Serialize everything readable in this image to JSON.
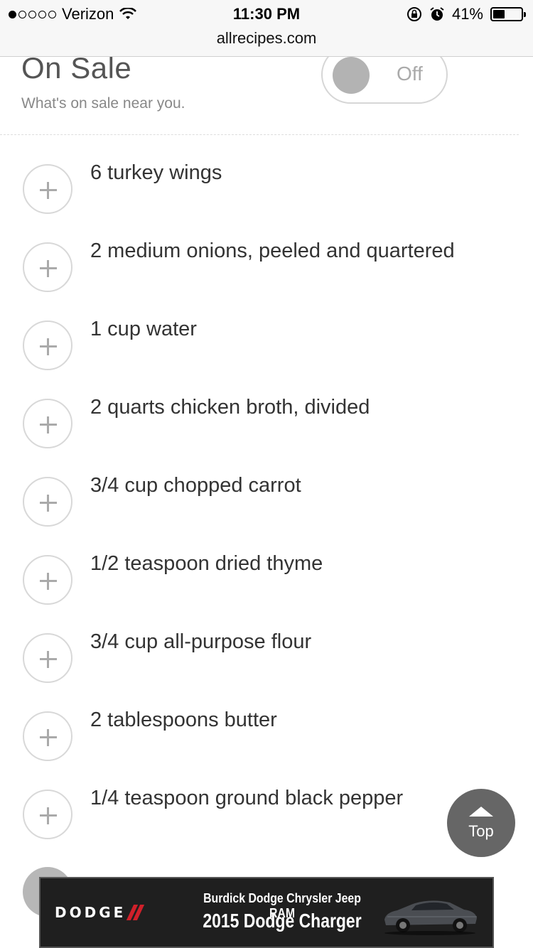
{
  "status_bar": {
    "carrier": "Verizon",
    "time": "11:30 PM",
    "battery_percent": "41%",
    "battery_level": 0.41,
    "signal_bars_filled": 1,
    "signal_bars_total": 5
  },
  "browser": {
    "url": "allrecipes.com"
  },
  "on_sale": {
    "title": "On Sale",
    "subtitle": "What's on sale near you.",
    "toggle_label": "Off",
    "toggle_on": false
  },
  "ingredients": [
    {
      "label": "6 turkey wings"
    },
    {
      "label": "2 medium onions, peeled and quartered"
    },
    {
      "label": "1 cup water"
    },
    {
      "label": "2 quarts chicken broth, divided"
    },
    {
      "label": "3/4 cup chopped carrot"
    },
    {
      "label": "1/2 teaspoon dried thyme"
    },
    {
      "label": "3/4 cup all-purpose flour"
    },
    {
      "label": "2 tablespoons butter"
    },
    {
      "label": "1/4 teaspoon ground black pepper"
    }
  ],
  "back_to_top": {
    "label": "Top"
  },
  "ad": {
    "brand": "DODGE",
    "dealer": "Burdick Dodge Chrysler Jeep RAM",
    "headline": "2015 Dodge Charger"
  },
  "colors": {
    "accent_red": "#d0202a",
    "text": "#333333",
    "muted": "#888888",
    "top_button": "#666666"
  }
}
